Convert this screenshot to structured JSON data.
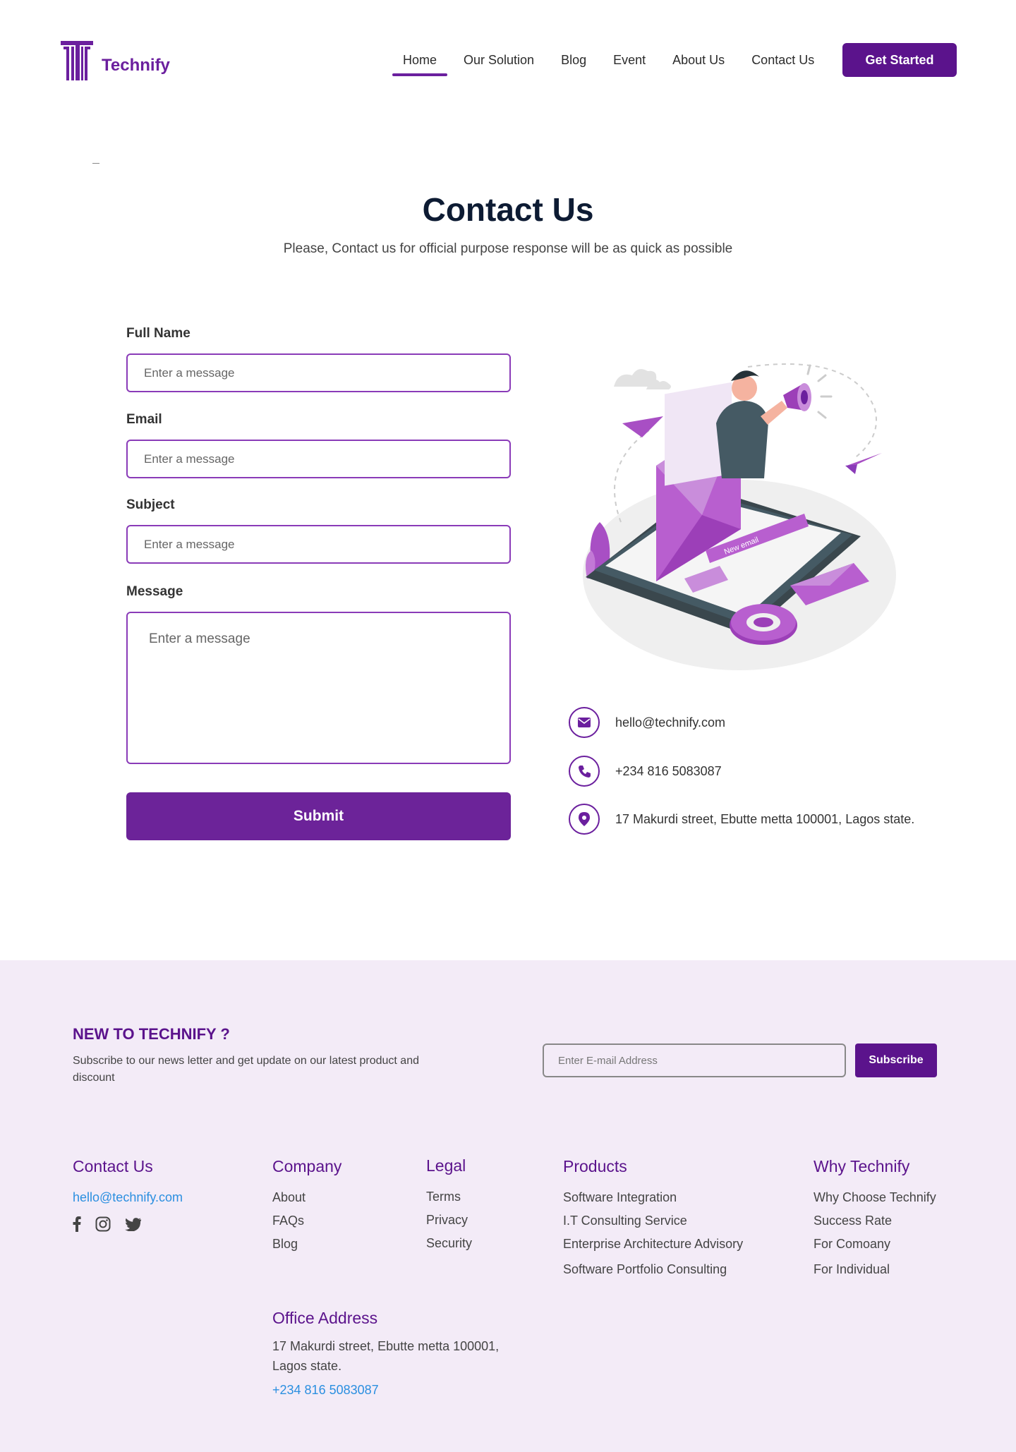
{
  "brand": {
    "name": "Technify"
  },
  "nav": {
    "items": [
      {
        "label": "Home",
        "active": true
      },
      {
        "label": "Our Solution",
        "active": false
      },
      {
        "label": "Blog",
        "active": false
      },
      {
        "label": "Event",
        "active": false
      },
      {
        "label": "About Us",
        "active": false
      },
      {
        "label": "Contact Us",
        "active": false
      }
    ],
    "cta": "Get Started"
  },
  "hero": {
    "title": "Contact Us",
    "subtitle": "Please, Contact us for official purpose response will be as quick as possible"
  },
  "form": {
    "full_name": {
      "label": "Full Name",
      "placeholder": "Enter a message"
    },
    "email": {
      "label": "Email",
      "placeholder": "Enter a message"
    },
    "subject": {
      "label": "Subject",
      "placeholder": "Enter a message"
    },
    "message": {
      "label": "Message",
      "placeholder": "Enter a message"
    },
    "submit": "Submit"
  },
  "illustration": {
    "badge": "New email"
  },
  "contact_info": {
    "email": "hello@technify.com",
    "phone": "+234 816 5083087",
    "address": "17 Makurdi street, Ebutte metta 100001, Lagos state."
  },
  "newsletter": {
    "title": "NEW TO TECHNIFY ?",
    "text": "Subscribe to our news letter and get update on our latest product and discount",
    "placeholder": "Enter E-mail Address",
    "button": "Subscribe"
  },
  "footer": {
    "contact": {
      "title": "Contact Us",
      "email": "hello@technify.com"
    },
    "company": {
      "title": "Company",
      "links": [
        "About",
        "FAQs",
        "Blog"
      ]
    },
    "legal": {
      "title": "Legal",
      "links": [
        "Terms",
        "Privacy",
        "Security"
      ]
    },
    "products": {
      "title": "Products",
      "links": [
        "Software Integration",
        "I.T Consulting Service",
        "Enterprise Architecture Advisory",
        "Software Portfolio Consulting"
      ]
    },
    "why": {
      "title": "Why Technify",
      "links": [
        "Why Choose Technify",
        "Success Rate",
        "For Comoany",
        "For Individual"
      ]
    },
    "office": {
      "title": "Office Address",
      "address": "17 Makurdi street, Ebutte metta 100001, Lagos state.",
      "phone": "+234 816 5083087"
    }
  },
  "colors": {
    "brand": "#5b138c",
    "accent": "#8a3bb8",
    "footer_bg": "#f3ebf7",
    "link": "#2b8fe0"
  }
}
